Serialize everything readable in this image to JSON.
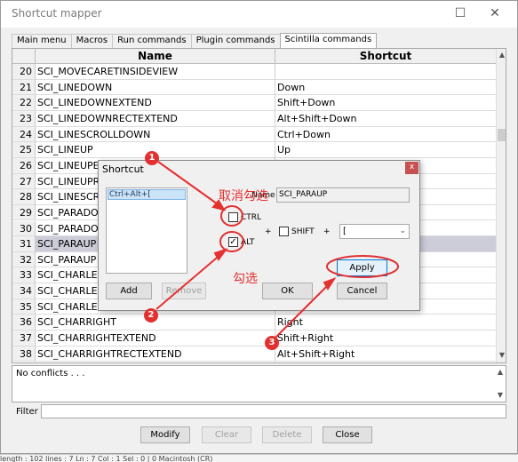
{
  "window": {
    "title": "Shortcut mapper",
    "minimize": "☐",
    "close": "✕"
  },
  "tabs": [
    {
      "label": "Main menu"
    },
    {
      "label": "Macros"
    },
    {
      "label": "Run commands"
    },
    {
      "label": "Plugin commands"
    },
    {
      "label": "Scintilla commands"
    }
  ],
  "grid": {
    "col_name": "Name",
    "col_shortcut": "Shortcut",
    "rows": [
      {
        "num": "20",
        "name": "SCI_MOVECARETINSIDEVIEW",
        "shortcut": ""
      },
      {
        "num": "21",
        "name": "SCI_LINEDOWN",
        "shortcut": "Down"
      },
      {
        "num": "22",
        "name": "SCI_LINEDOWNEXTEND",
        "shortcut": "Shift+Down"
      },
      {
        "num": "23",
        "name": "SCI_LINEDOWNRECTEXTEND",
        "shortcut": "Alt+Shift+Down"
      },
      {
        "num": "24",
        "name": "SCI_LINESCROLLDOWN",
        "shortcut": "Ctrl+Down"
      },
      {
        "num": "25",
        "name": "SCI_LINEUP",
        "shortcut": "Up"
      },
      {
        "num": "26",
        "name": "SCI_LINEUPE",
        "shortcut": ""
      },
      {
        "num": "27",
        "name": "SCI_LINEUPR",
        "shortcut": ""
      },
      {
        "num": "28",
        "name": "SCI_LINESCR",
        "shortcut": ""
      },
      {
        "num": "29",
        "name": "SCI_PARADO",
        "shortcut": ""
      },
      {
        "num": "30",
        "name": "SCI_PARADO",
        "shortcut": ""
      },
      {
        "num": "31",
        "name": "SCI_PARAUP",
        "shortcut": ""
      },
      {
        "num": "32",
        "name": "SCI_PARAUP",
        "shortcut": ""
      },
      {
        "num": "33",
        "name": "SCI_CHARLEI",
        "shortcut": ""
      },
      {
        "num": "34",
        "name": "SCI_CHARLEI",
        "shortcut": ""
      },
      {
        "num": "35",
        "name": "SCI_CHARLEI",
        "shortcut": ""
      },
      {
        "num": "36",
        "name": "SCI_CHARRIGHT",
        "shortcut": "Right"
      },
      {
        "num": "37",
        "name": "SCI_CHARRIGHTEXTEND",
        "shortcut": "Shift+Right"
      },
      {
        "num": "38",
        "name": "SCI_CHARRIGHTRECTEXTEND",
        "shortcut": "Alt+Shift+Right"
      }
    ]
  },
  "conflicts": {
    "text": "No conflicts . . ."
  },
  "filter": {
    "label": "Filter :",
    "value": ""
  },
  "buttons": {
    "modify": "Modify",
    "clear": "Clear",
    "delete": "Delete",
    "close": "Close"
  },
  "dialog": {
    "title": "Shortcut",
    "close": "x",
    "list_item": "Ctrl+Alt+[",
    "name_label": "Name",
    "name_value": "SCI_PARAUP",
    "ctrl_label": "CTRL",
    "alt_label": "ALT",
    "shift_label": "SHIFT",
    "plus": "+",
    "key_value": "[",
    "add": "Add",
    "remove": "Remove",
    "apply": "Apply",
    "ok": "OK",
    "cancel": "Cancel",
    "ctrl_checked": false,
    "alt_checked": true,
    "shift_checked": false
  },
  "annotations": {
    "badge1": "1",
    "badge2": "2",
    "badge3": "3",
    "uncheck_text": "取消勾选",
    "check_text": "勾选",
    "color": "#e53030"
  },
  "statusbar": {
    "text": "length : 102    lines : 7         Ln : 7    Col : 1    Sel : 0 | 0                 Macintosh (CR)"
  }
}
